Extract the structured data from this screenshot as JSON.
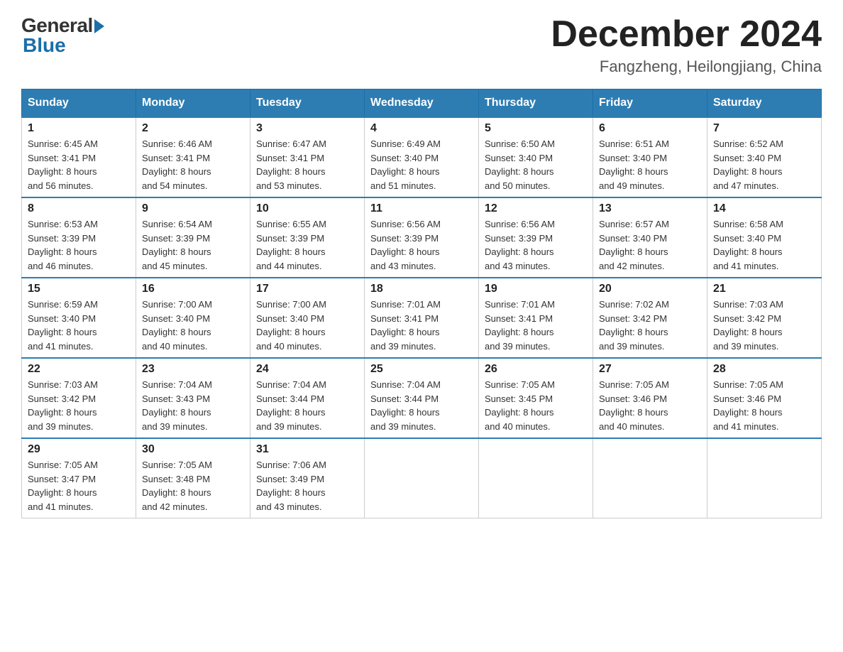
{
  "logo": {
    "general": "General",
    "blue": "Blue"
  },
  "title": "December 2024",
  "subtitle": "Fangzheng, Heilongjiang, China",
  "weekdays": [
    "Sunday",
    "Monday",
    "Tuesday",
    "Wednesday",
    "Thursday",
    "Friday",
    "Saturday"
  ],
  "weeks": [
    [
      {
        "day": "1",
        "sunrise": "6:45 AM",
        "sunset": "3:41 PM",
        "daylight": "8 hours and 56 minutes."
      },
      {
        "day": "2",
        "sunrise": "6:46 AM",
        "sunset": "3:41 PM",
        "daylight": "8 hours and 54 minutes."
      },
      {
        "day": "3",
        "sunrise": "6:47 AM",
        "sunset": "3:41 PM",
        "daylight": "8 hours and 53 minutes."
      },
      {
        "day": "4",
        "sunrise": "6:49 AM",
        "sunset": "3:40 PM",
        "daylight": "8 hours and 51 minutes."
      },
      {
        "day": "5",
        "sunrise": "6:50 AM",
        "sunset": "3:40 PM",
        "daylight": "8 hours and 50 minutes."
      },
      {
        "day": "6",
        "sunrise": "6:51 AM",
        "sunset": "3:40 PM",
        "daylight": "8 hours and 49 minutes."
      },
      {
        "day": "7",
        "sunrise": "6:52 AM",
        "sunset": "3:40 PM",
        "daylight": "8 hours and 47 minutes."
      }
    ],
    [
      {
        "day": "8",
        "sunrise": "6:53 AM",
        "sunset": "3:39 PM",
        "daylight": "8 hours and 46 minutes."
      },
      {
        "day": "9",
        "sunrise": "6:54 AM",
        "sunset": "3:39 PM",
        "daylight": "8 hours and 45 minutes."
      },
      {
        "day": "10",
        "sunrise": "6:55 AM",
        "sunset": "3:39 PM",
        "daylight": "8 hours and 44 minutes."
      },
      {
        "day": "11",
        "sunrise": "6:56 AM",
        "sunset": "3:39 PM",
        "daylight": "8 hours and 43 minutes."
      },
      {
        "day": "12",
        "sunrise": "6:56 AM",
        "sunset": "3:39 PM",
        "daylight": "8 hours and 43 minutes."
      },
      {
        "day": "13",
        "sunrise": "6:57 AM",
        "sunset": "3:40 PM",
        "daylight": "8 hours and 42 minutes."
      },
      {
        "day": "14",
        "sunrise": "6:58 AM",
        "sunset": "3:40 PM",
        "daylight": "8 hours and 41 minutes."
      }
    ],
    [
      {
        "day": "15",
        "sunrise": "6:59 AM",
        "sunset": "3:40 PM",
        "daylight": "8 hours and 41 minutes."
      },
      {
        "day": "16",
        "sunrise": "7:00 AM",
        "sunset": "3:40 PM",
        "daylight": "8 hours and 40 minutes."
      },
      {
        "day": "17",
        "sunrise": "7:00 AM",
        "sunset": "3:40 PM",
        "daylight": "8 hours and 40 minutes."
      },
      {
        "day": "18",
        "sunrise": "7:01 AM",
        "sunset": "3:41 PM",
        "daylight": "8 hours and 39 minutes."
      },
      {
        "day": "19",
        "sunrise": "7:01 AM",
        "sunset": "3:41 PM",
        "daylight": "8 hours and 39 minutes."
      },
      {
        "day": "20",
        "sunrise": "7:02 AM",
        "sunset": "3:42 PM",
        "daylight": "8 hours and 39 minutes."
      },
      {
        "day": "21",
        "sunrise": "7:03 AM",
        "sunset": "3:42 PM",
        "daylight": "8 hours and 39 minutes."
      }
    ],
    [
      {
        "day": "22",
        "sunrise": "7:03 AM",
        "sunset": "3:42 PM",
        "daylight": "8 hours and 39 minutes."
      },
      {
        "day": "23",
        "sunrise": "7:04 AM",
        "sunset": "3:43 PM",
        "daylight": "8 hours and 39 minutes."
      },
      {
        "day": "24",
        "sunrise": "7:04 AM",
        "sunset": "3:44 PM",
        "daylight": "8 hours and 39 minutes."
      },
      {
        "day": "25",
        "sunrise": "7:04 AM",
        "sunset": "3:44 PM",
        "daylight": "8 hours and 39 minutes."
      },
      {
        "day": "26",
        "sunrise": "7:05 AM",
        "sunset": "3:45 PM",
        "daylight": "8 hours and 40 minutes."
      },
      {
        "day": "27",
        "sunrise": "7:05 AM",
        "sunset": "3:46 PM",
        "daylight": "8 hours and 40 minutes."
      },
      {
        "day": "28",
        "sunrise": "7:05 AM",
        "sunset": "3:46 PM",
        "daylight": "8 hours and 41 minutes."
      }
    ],
    [
      {
        "day": "29",
        "sunrise": "7:05 AM",
        "sunset": "3:47 PM",
        "daylight": "8 hours and 41 minutes."
      },
      {
        "day": "30",
        "sunrise": "7:05 AM",
        "sunset": "3:48 PM",
        "daylight": "8 hours and 42 minutes."
      },
      {
        "day": "31",
        "sunrise": "7:06 AM",
        "sunset": "3:49 PM",
        "daylight": "8 hours and 43 minutes."
      },
      null,
      null,
      null,
      null
    ]
  ],
  "labels": {
    "sunrise": "Sunrise:",
    "sunset": "Sunset:",
    "daylight": "Daylight:"
  }
}
